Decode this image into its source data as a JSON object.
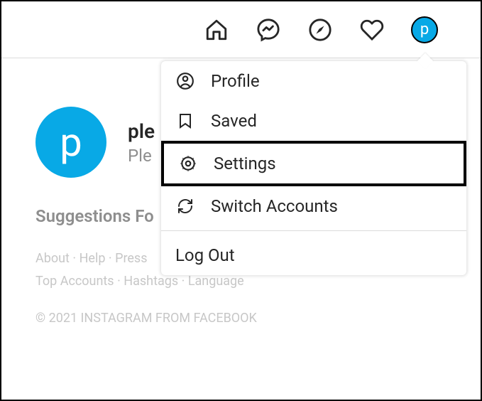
{
  "nav": {
    "avatar_initial": "p"
  },
  "dropdown": {
    "items": [
      {
        "label": "Profile"
      },
      {
        "label": "Saved"
      },
      {
        "label": "Settings"
      },
      {
        "label": "Switch Accounts"
      }
    ],
    "logout": "Log Out"
  },
  "profile": {
    "username": "ple",
    "display_name": "Ple",
    "avatar_initial": "p"
  },
  "suggestions": {
    "title": "Suggestions Fo"
  },
  "footer": {
    "links_line1": [
      "About",
      "Help",
      "Press"
    ],
    "links_line2": [
      "Top Accounts",
      "Hashtags",
      "Language"
    ],
    "copyright": "© 2021 INSTAGRAM FROM FACEBOOK"
  }
}
